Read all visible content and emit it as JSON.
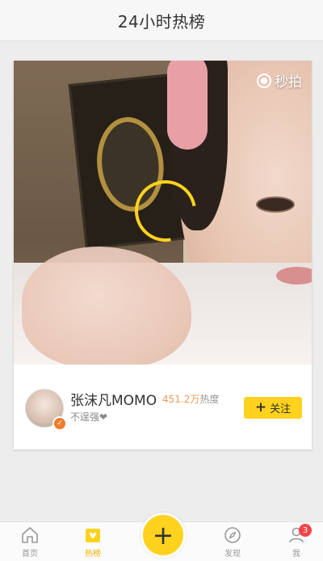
{
  "header": {
    "title": "24小时热榜"
  },
  "video": {
    "brand_label": "秒拍"
  },
  "user": {
    "name": "张沫凡MOMO",
    "heat_value": "451.2万",
    "heat_label": "热度",
    "bio": "不逞强❤",
    "follow_label": "关注"
  },
  "tabbar": {
    "items": [
      {
        "label": "首页",
        "icon": "home-icon"
      },
      {
        "label": "热榜",
        "icon": "hot-list-icon"
      },
      {
        "label": "发现",
        "icon": "compass-icon"
      },
      {
        "label": "我",
        "icon": "profile-icon",
        "badge": "3"
      }
    ],
    "active": "热榜"
  },
  "colors": {
    "accent": "#ffd21e",
    "heat": "#f09b54",
    "badge": "#f5454a"
  }
}
